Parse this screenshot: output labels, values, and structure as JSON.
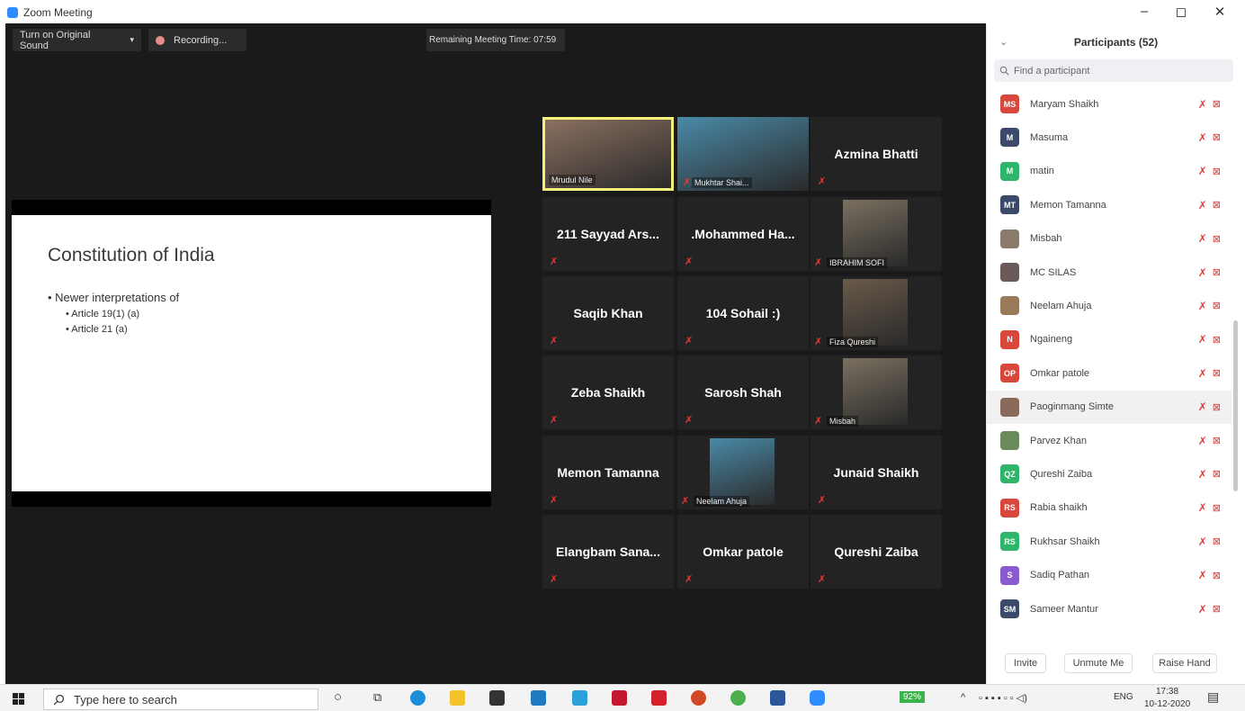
{
  "window": {
    "title": "Zoom Meeting",
    "minimize": "–",
    "maximize": "◻",
    "close": "✕"
  },
  "toolbar": {
    "sound_label": "Turn on Original Sound",
    "sound_caret": "▾",
    "recording_label": "Recording...",
    "remaining_time": "Remaining Meeting Time: 07:59"
  },
  "slide": {
    "title": "Constitution of India",
    "bullet1": "• Newer interpretations of",
    "sub1": "• Article 19(1) (a)",
    "sub2": "• Article 21 (a)"
  },
  "tiles": [
    {
      "name": "Mrudul Nile",
      "video": true
    },
    {
      "name": "Mukhtar Shai...",
      "video": true
    },
    {
      "name": "Azmina Bhatti",
      "video": false
    },
    {
      "name": "211 Sayyad Ars...",
      "video": false
    },
    {
      "name": ".Mohammed Ha...",
      "video": false
    },
    {
      "name": "IBRAHIM SOFI",
      "video": true
    },
    {
      "name": "Saqib Khan",
      "video": false
    },
    {
      "name": "104 Sohail :)",
      "video": false
    },
    {
      "name": "Fiza Qureshi",
      "video": true
    },
    {
      "name": "Zeba Shaikh",
      "video": false
    },
    {
      "name": "Sarosh Shah",
      "video": false
    },
    {
      "name": "Misbah",
      "video": true
    },
    {
      "name": "Memon Tamanna",
      "video": false
    },
    {
      "name": "Neelam Ahuja",
      "video": true
    },
    {
      "name": "Junaid Shaikh",
      "video": false
    },
    {
      "name": "Elangbam Sana...",
      "video": false
    },
    {
      "name": "Omkar patole",
      "video": false
    },
    {
      "name": "Qureshi Zaiba",
      "video": false
    }
  ],
  "panel": {
    "title": "Participants (52)",
    "collapse_icon": "⌄",
    "search_placeholder": "Find a participant",
    "participants": [
      {
        "initials": "MS",
        "name": "Maryam Shaikh",
        "color": "#d9463b"
      },
      {
        "initials": "M",
        "name": "Masuma",
        "color": "#3b4a6b"
      },
      {
        "initials": "M",
        "name": "matin",
        "color": "#2fb56a"
      },
      {
        "initials": "MT",
        "name": "Memon Tamanna",
        "color": "#3b4a6b"
      },
      {
        "initials": "",
        "name": "Misbah",
        "color": "#8a7a6a"
      },
      {
        "initials": "",
        "name": "MC SILAS",
        "color": "#6a5a5a"
      },
      {
        "initials": "",
        "name": "Neelam Ahuja",
        "color": "#9a7a5a"
      },
      {
        "initials": "N",
        "name": "Ngaineng",
        "color": "#d9463b"
      },
      {
        "initials": "OP",
        "name": "Omkar patole",
        "color": "#d9463b"
      },
      {
        "initials": "",
        "name": "Paoginmang Simte",
        "color": "#8a6a5a"
      },
      {
        "initials": "",
        "name": "Parvez Khan",
        "color": "#6a8a5a"
      },
      {
        "initials": "QZ",
        "name": "Qureshi Zaiba",
        "color": "#2fb56a"
      },
      {
        "initials": "RS",
        "name": "Rabia shaikh",
        "color": "#d9463b"
      },
      {
        "initials": "RS",
        "name": "Rukhsar Shaikh",
        "color": "#2fb56a"
      },
      {
        "initials": "S",
        "name": "Sadiq Pathan",
        "color": "#8a5ad0"
      },
      {
        "initials": "SM",
        "name": "Sameer Mantur",
        "color": "#3b4a6b"
      }
    ],
    "invite": "Invite",
    "unmute": "Unmute Me",
    "raise_hand": "Raise Hand"
  },
  "taskbar": {
    "search_placeholder": "Type here to search",
    "battery": "92%",
    "lang": "ENG",
    "time": "17:38",
    "date": "10-12-2020"
  }
}
